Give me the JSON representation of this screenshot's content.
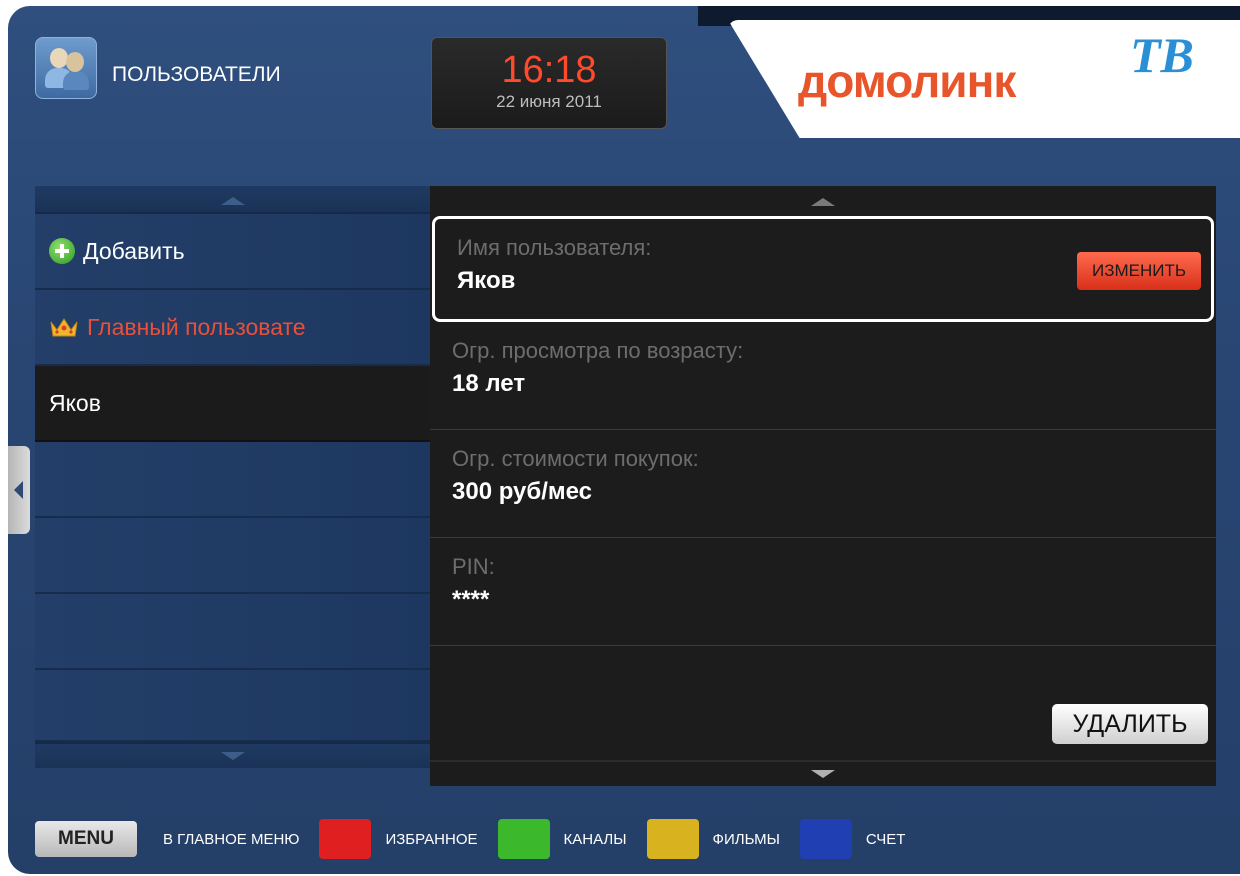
{
  "header": {
    "title": "ПОЛЬЗОВАТЕЛИ",
    "icon": "users-icon",
    "time": "16:18",
    "date": "22 июня 2011",
    "logo_text": "домолинк",
    "logo_tv": "ТВ"
  },
  "user_list": {
    "items": [
      {
        "label": "Добавить",
        "icon": "add-icon"
      },
      {
        "label": "Главный пользовате",
        "icon": "crown-icon"
      },
      {
        "label": "Яков",
        "selected": true
      },
      {
        "label": ""
      },
      {
        "label": ""
      },
      {
        "label": ""
      },
      {
        "label": ""
      }
    ]
  },
  "details": {
    "fields": [
      {
        "label": "Имя пользователя:",
        "value": "Яков"
      },
      {
        "label": "Огр. просмотра по возрасту:",
        "value": "18 лет"
      },
      {
        "label": "Огр. стоимости покупок:",
        "value": "300 руб/мес"
      },
      {
        "label": "PIN:",
        "value": "****"
      }
    ],
    "change_button": "ИЗМЕНИТЬ",
    "delete_button": "УДАЛИТЬ"
  },
  "footer": {
    "menu_key": "MENU",
    "main_menu": "В ГЛАВНОЕ МЕНЮ",
    "favorites": "ИЗБРАННОЕ",
    "channels": "КАНАЛЫ",
    "movies": "ФИЛЬМЫ",
    "account": "СЧЕТ",
    "colors": {
      "red": "#e02020",
      "green": "#3cb82c",
      "yellow": "#d9b21f",
      "blue": "#1f3fb2"
    }
  },
  "colors": {
    "accent": "#ff4a2c",
    "panel_bg": "#1c1c1c",
    "frame_bg": "#2c4b79"
  }
}
